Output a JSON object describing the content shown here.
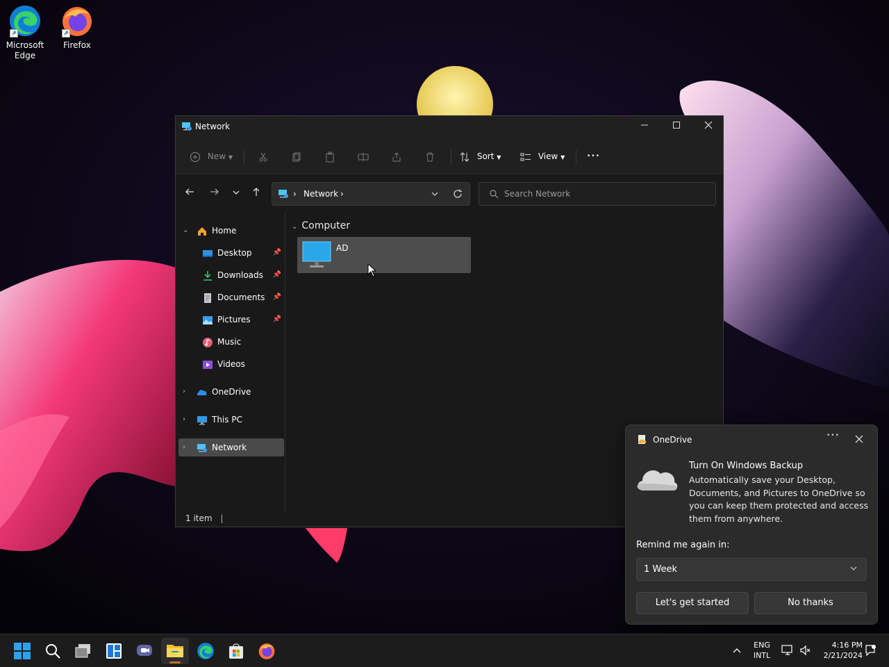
{
  "desktop": {
    "icons": [
      {
        "label": "Microsoft Edge"
      },
      {
        "label": "Firefox"
      }
    ]
  },
  "explorer": {
    "title": "Network",
    "commands": {
      "new": "New",
      "sort": "Sort",
      "view": "View",
      "more": "•••"
    },
    "address": {
      "crumbs": [
        "Network"
      ]
    },
    "search": {
      "placeholder": "Search Network"
    },
    "sidebar": {
      "home": "Home",
      "quick_access": [
        {
          "label": "Desktop",
          "pinned": true
        },
        {
          "label": "Downloads",
          "pinned": true
        },
        {
          "label": "Documents",
          "pinned": true
        },
        {
          "label": "Pictures",
          "pinned": true
        },
        {
          "label": "Music",
          "pinned": false
        },
        {
          "label": "Videos",
          "pinned": false
        }
      ],
      "onedrive": "OneDrive",
      "this_pc": "This PC",
      "network": "Network"
    },
    "content": {
      "group": "Computer",
      "items": [
        {
          "label": "AD"
        }
      ]
    },
    "status": "1 item"
  },
  "toast": {
    "app": "OneDrive",
    "heading": "Turn On Windows Backup",
    "body": "Automatically save your Desktop, Documents, and Pictures to OneDrive so you can keep them protected and access them from anywhere.",
    "remind_label": "Remind me again in:",
    "remind_value": "1 Week",
    "primary_button": "Let's get started",
    "secondary_button": "No thanks"
  },
  "taskbar": {
    "language": {
      "line1": "ENG",
      "line2": "INTL"
    },
    "time": "4:16 PM",
    "date": "2/21/2024"
  },
  "colors": {
    "accent": "#0078d4",
    "window_bg": "#191919",
    "selection": "#4d4d4d"
  }
}
